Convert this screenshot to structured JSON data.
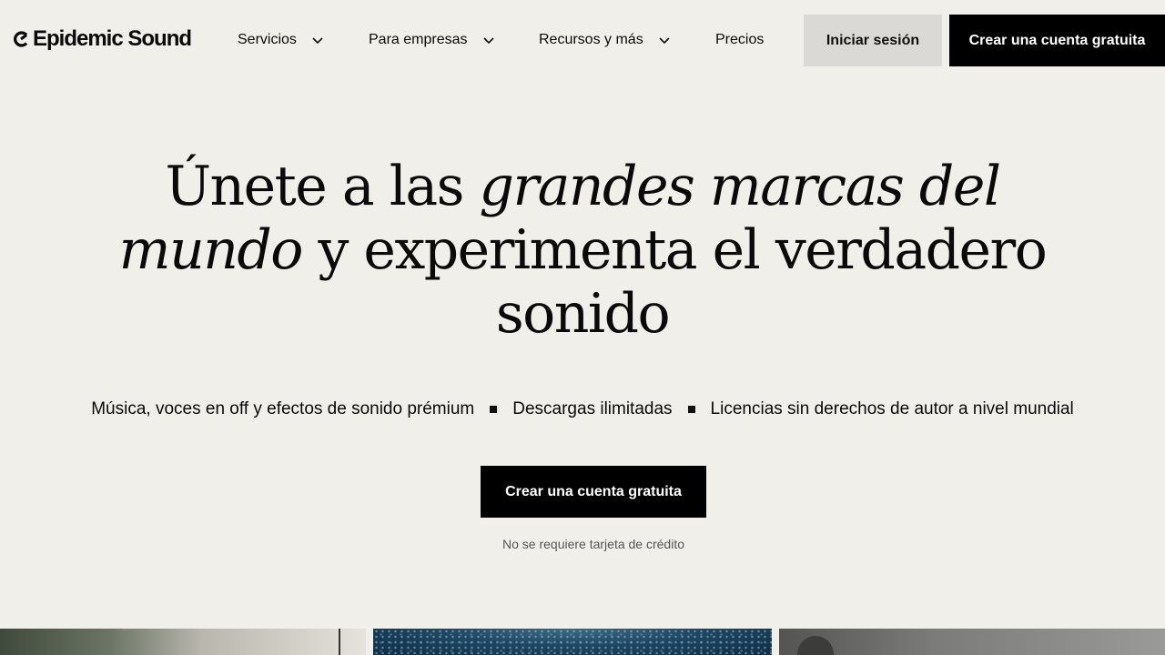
{
  "brand": {
    "name": "Epidemic Sound",
    "logo_icon": "epidemic-sound-logo-mark"
  },
  "nav": {
    "items": [
      {
        "label": "Servicios",
        "has_dropdown": true
      },
      {
        "label": "Para empresas",
        "has_dropdown": true
      },
      {
        "label": "Recursos y más",
        "has_dropdown": true
      },
      {
        "label": "Precios",
        "has_dropdown": false
      }
    ],
    "login_label": "Iniciar sesión",
    "signup_label": "Crear una cuenta gratuita",
    "chevron_icon": "chevron-down-icon"
  },
  "hero": {
    "title_part1": "Únete a las ",
    "title_italic1": "grandes marcas del mundo",
    "title_part2": " y experimenta el verdadero sonido",
    "features": [
      "Música, voces en off y efectos de sonido prémium",
      "Descargas ilimitadas",
      "Licencias sin derechos de autor a nivel mundial"
    ],
    "cta_label": "Crear una cuenta gratuita",
    "note": "No se requiere tarjeta de crédito"
  },
  "colors": {
    "background": "#f0efea",
    "primary_button": "#000000",
    "secondary_button": "#dad9d5",
    "text": "#0a0a0a",
    "muted_text": "#555555"
  }
}
